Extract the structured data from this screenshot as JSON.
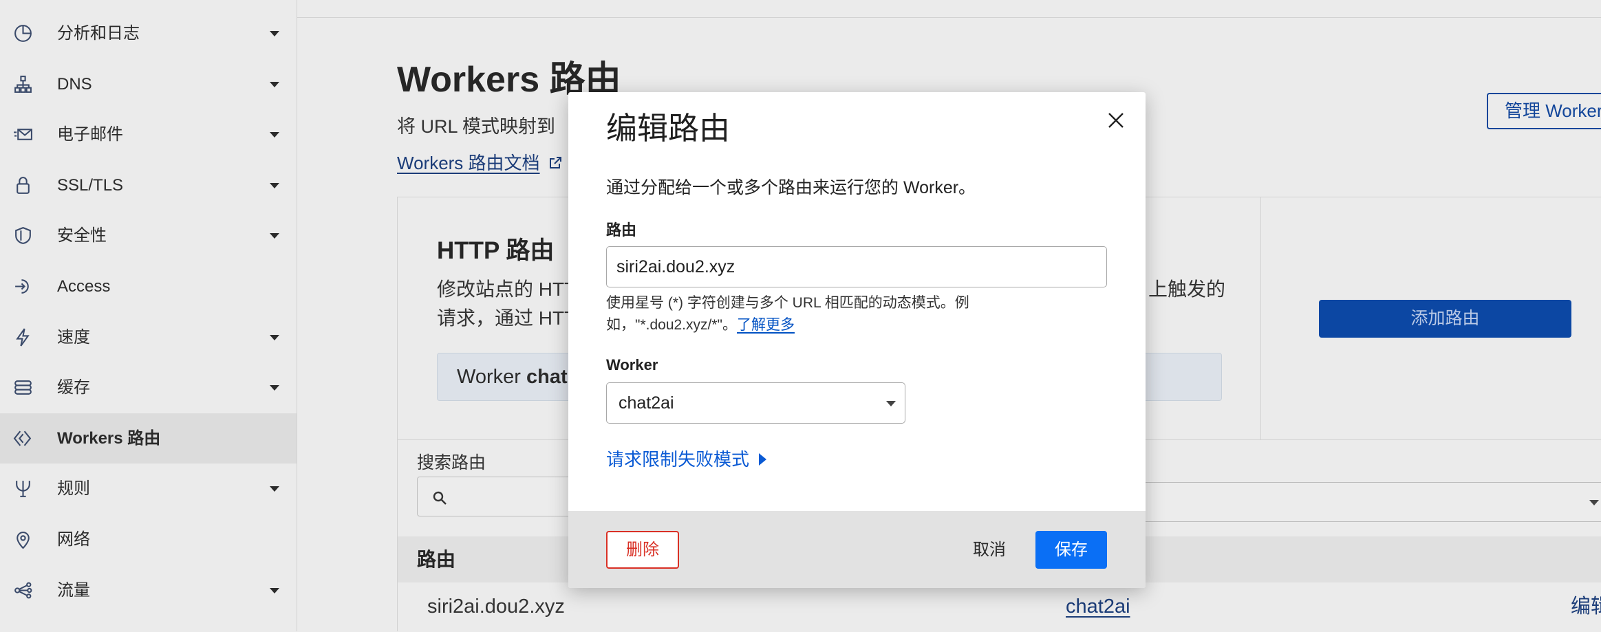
{
  "sidebar": {
    "items": [
      {
        "label": "分析和日志",
        "icon": "pie-chart-icon",
        "expandable": true
      },
      {
        "label": "DNS",
        "icon": "network-icon",
        "expandable": true
      },
      {
        "label": "电子邮件",
        "icon": "envelope-icon",
        "expandable": true
      },
      {
        "label": "SSL/TLS",
        "icon": "lock-icon",
        "expandable": true
      },
      {
        "label": "安全性",
        "icon": "shield-icon",
        "expandable": true
      },
      {
        "label": "Access",
        "icon": "access-icon",
        "expandable": false
      },
      {
        "label": "速度",
        "icon": "lightning-icon",
        "expandable": true
      },
      {
        "label": "缓存",
        "icon": "cache-icon",
        "expandable": true
      },
      {
        "label": "Workers 路由",
        "icon": "workers-icon",
        "expandable": false,
        "active": true
      },
      {
        "label": "规则",
        "icon": "rules-icon",
        "expandable": true
      },
      {
        "label": "网络",
        "icon": "location-pin-icon",
        "expandable": false
      },
      {
        "label": "流量",
        "icon": "traffic-icon",
        "expandable": true
      }
    ]
  },
  "header": {
    "title": "Workers 路由",
    "subtitle": "将 URL 模式映射到",
    "docs_link": "Workers 路由文档",
    "docs_icon": "external-link-icon",
    "manage_button": "管理 Worker"
  },
  "http_routes": {
    "heading": "HTTP 路由",
    "desc_line1": "修改站点的 HTT",
    "desc_line2": "请求，通过 HTT",
    "desc_right": "上触发的",
    "notice_prefix": "Worker",
    "notice_name": "chat",
    "add_button": "添加路由"
  },
  "search": {
    "label": "搜索路由",
    "icon": "search-icon"
  },
  "table": {
    "header_route": "路由",
    "rows": [
      {
        "route": "siri2ai.dou2.xyz",
        "worker": "chat2ai",
        "action": "编辑"
      }
    ]
  },
  "modal": {
    "title": "编辑路由",
    "close_icon": "close-icon",
    "description": "通过分配给一个或多个路由来运行您的 Worker。",
    "route_label": "路由",
    "route_value": "siri2ai.dou2.xyz",
    "help_line1": "使用星号 (*) 字符创建与多个 URL 相匹配的动态模式。例",
    "help_line2": "如，\"*.dou2.xyz/*\"。",
    "learn_more": "了解更多",
    "worker_label": "Worker",
    "worker_value": "chat2ai",
    "fail_mode_link": "请求限制失败模式",
    "delete_button": "删除",
    "cancel_button": "取消",
    "save_button": "保存"
  },
  "colors": {
    "primary": "#0a6ff5",
    "danger": "#d93025",
    "link": "#0051c3",
    "dimmed_primary": "#0c47a3"
  }
}
